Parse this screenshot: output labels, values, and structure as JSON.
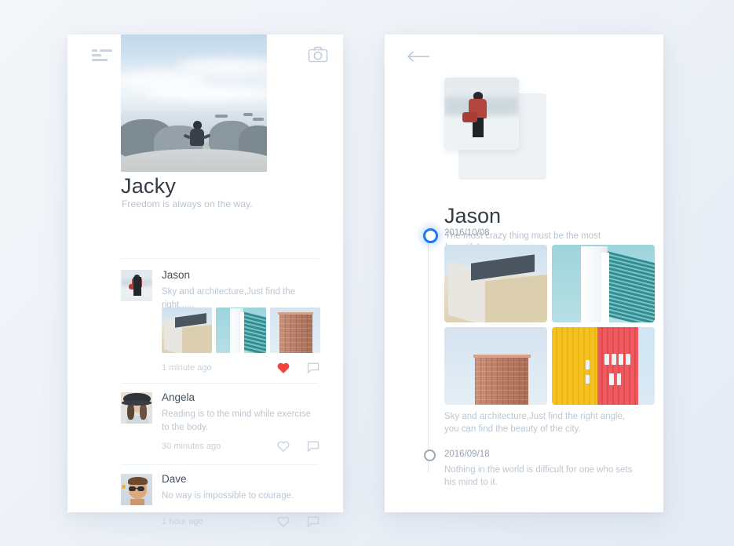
{
  "background_color": "#eef2f7",
  "left_screen": {
    "topbar": {
      "menu_icon": "hamburger-menu-icon",
      "camera_icon": "camera-icon"
    },
    "profile": {
      "hero_image": "man-sitting-on-rock-overlooking-sea",
      "name": "Jacky",
      "motto": "Freedom is always on the way."
    },
    "feed": [
      {
        "avatar": "jason-avatar-man-with-red-coat",
        "name": "Jason",
        "text": "Sky and architecture,Just find the right......",
        "time": "1 minute ago",
        "liked": true,
        "like_icon": "heart-icon",
        "comment_icon": "comment-icon",
        "thumbs": [
          "beige-concrete-building",
          "white-tower-teal-sky",
          "terracotta-flatiron-building"
        ]
      },
      {
        "avatar": "angela-avatar-woman-with-hat",
        "name": "Angela",
        "text": "Reading is to the mind while exercise to the body.",
        "time": "30 minutes ago",
        "liked": false,
        "like_icon": "heart-icon",
        "comment_icon": "comment-icon",
        "thumbs": []
      },
      {
        "avatar": "dave-avatar-man-with-sunglasses",
        "name": "Dave",
        "text": "No way is impossible to courage.",
        "time": "1 hour ago",
        "liked": false,
        "like_icon": "heart-icon",
        "comment_icon": "comment-icon",
        "thumbs": []
      }
    ]
  },
  "right_screen": {
    "topbar": {
      "back_icon": "back-arrow-icon"
    },
    "profile": {
      "avatar": "jason-photo-man-with-red-coat",
      "name": "Jason",
      "motto": "The most crazy thing must be the most beautiful."
    },
    "timeline": [
      {
        "date": "2016/10/08",
        "active": true,
        "photos": [
          "beige-concrete-building",
          "white-and-teal-glass-tower",
          "terracotta-flatiron-building",
          "yellow-and-red-striped-facade"
        ],
        "text": "Sky and architecture,Just find the right angle, you can find the beauty of the city."
      },
      {
        "date": "2016/09/18",
        "active": false,
        "photos": [],
        "text": "Nothing in the world is difficult for one who sets his mind to it."
      }
    ]
  },
  "colors": {
    "accent_blue": "#1677ff",
    "heart_red": "#f0453f",
    "text_dark": "#333b44",
    "text_muted": "#bcc7d2",
    "card_white": "#ffffff"
  }
}
